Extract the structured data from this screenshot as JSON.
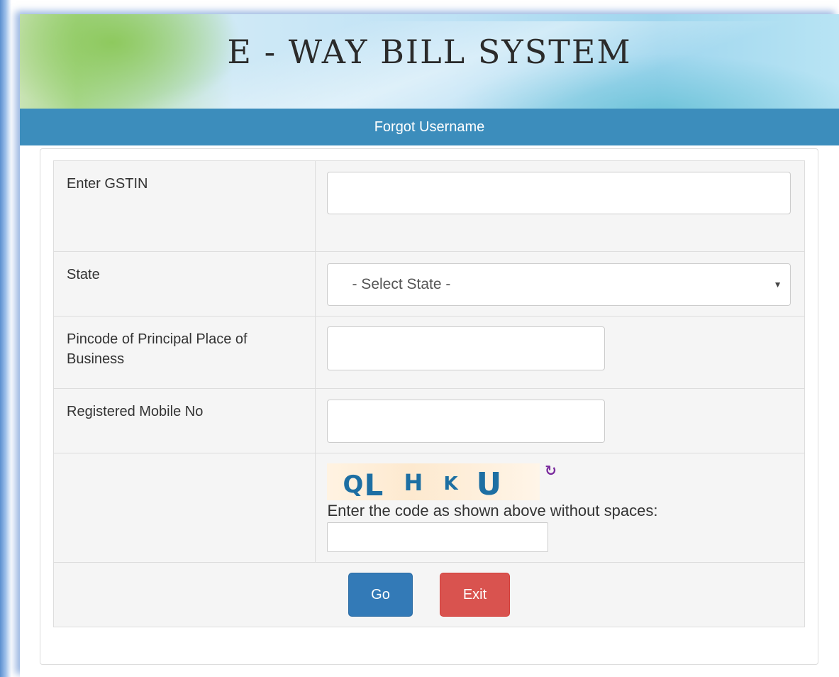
{
  "header": {
    "title": "E - WAY BILL SYSTEM",
    "subtitle": "Forgot Username"
  },
  "form": {
    "gstin_label": "Enter GSTIN",
    "gstin_value": "",
    "state_label": "State",
    "state_selected": "- Select State -",
    "pincode_label": "Pincode of Principal Place of Business",
    "pincode_value": "",
    "mobile_label": "Registered Mobile No",
    "mobile_value": "",
    "captcha_chars": [
      "Q",
      "L",
      "H",
      "K",
      "U"
    ],
    "captcha_hint": "Enter the code as shown above without spaces:",
    "captcha_value": ""
  },
  "actions": {
    "go_label": "Go",
    "exit_label": "Exit"
  },
  "icons": {
    "refresh": "refresh-icon",
    "dropdown": "chevron-down-icon"
  },
  "colors": {
    "header_bar": "#3c8dbc",
    "go_button": "#337ab7",
    "exit_button": "#d9534f",
    "captcha_text": "#1d6fa3",
    "refresh_icon": "#7b2c9e"
  }
}
